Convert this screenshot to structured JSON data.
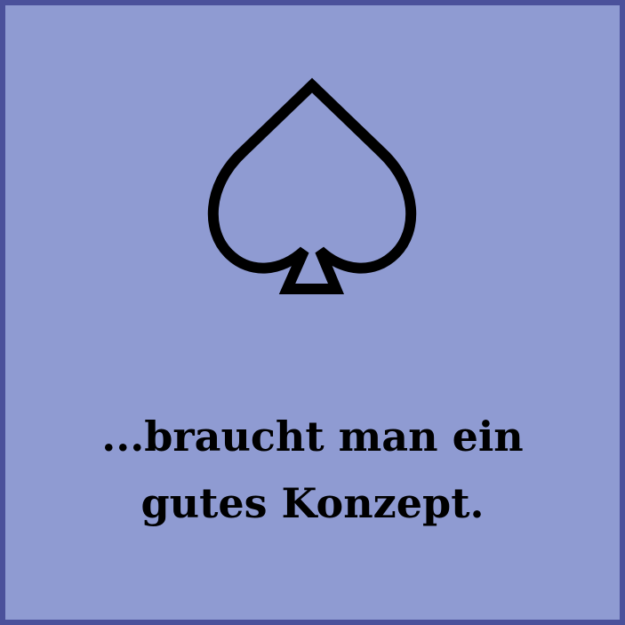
{
  "card": {
    "icon": "spade-outline-icon",
    "colors": {
      "background": "#8f9bd2",
      "border": "#4b519b",
      "ink": "#000000"
    },
    "caption_lines": [
      "...braucht man ein",
      "gutes Konzept."
    ]
  }
}
